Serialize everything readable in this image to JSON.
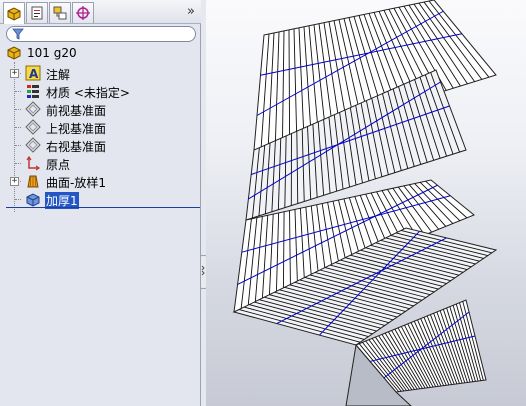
{
  "tabs": [
    {
      "name": "feature-manager",
      "icon": "feature-tree-icon",
      "active": true
    },
    {
      "name": "property-manager",
      "icon": "property-sheet-icon",
      "active": false
    },
    {
      "name": "configuration-manager",
      "icon": "configuration-icon",
      "active": false
    },
    {
      "name": "dimxpert-manager",
      "icon": "crosshair-target-icon",
      "active": false
    }
  ],
  "tabs_more": "»",
  "filter": {
    "icon": "filter-funnel-icon",
    "value": ""
  },
  "tree": {
    "root": {
      "label": "101 g20",
      "icon": "part-icon"
    },
    "items": [
      {
        "label": "注解",
        "icon": "annotations-icon",
        "expandable": true
      },
      {
        "label": "材质 <未指定>",
        "icon": "material-icon",
        "expandable": false
      },
      {
        "label": "前视基准面",
        "icon": "plane-icon",
        "expandable": false
      },
      {
        "label": "上视基准面",
        "icon": "plane-icon",
        "expandable": false
      },
      {
        "label": "右视基准面",
        "icon": "plane-icon",
        "expandable": false
      },
      {
        "label": "原点",
        "icon": "origin-icon",
        "expandable": false
      },
      {
        "label": "曲面-放样1",
        "icon": "surface-loft-icon",
        "expandable": true
      },
      {
        "label": "加厚1",
        "icon": "thicken-icon",
        "expandable": false,
        "selected": true
      }
    ]
  },
  "colors": {
    "panel_bg": "#e3e6ef",
    "selection": "#2457c5",
    "helix_edge": "#0000cc"
  }
}
